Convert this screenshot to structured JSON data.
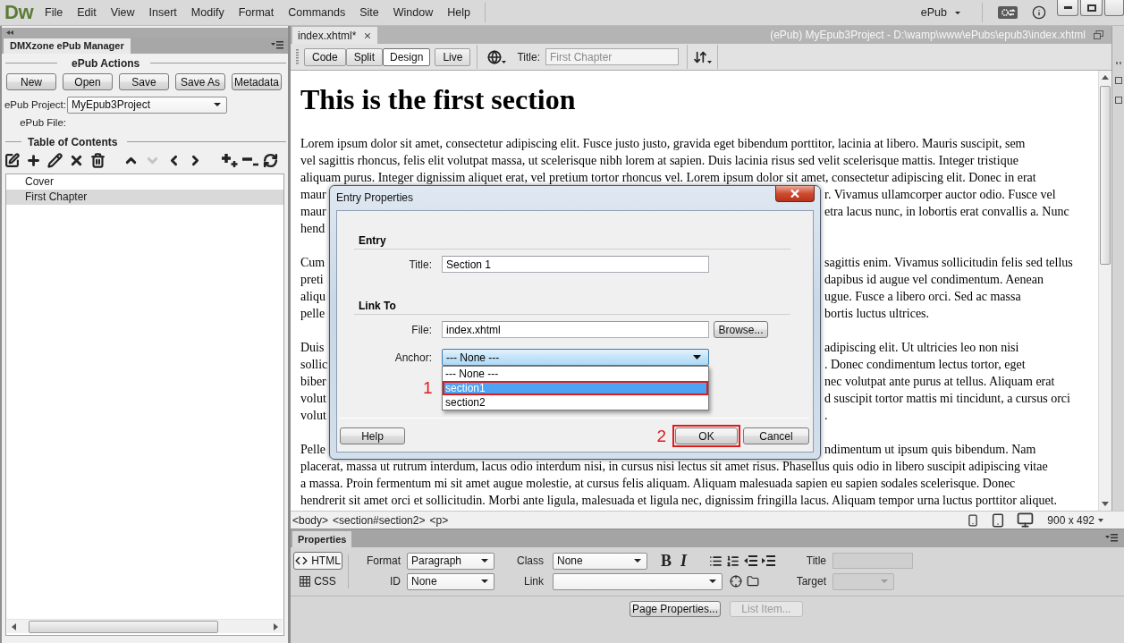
{
  "menu_bar": {
    "logo": "Dw",
    "items": [
      "File",
      "Edit",
      "View",
      "Insert",
      "Modify",
      "Format",
      "Commands",
      "Site",
      "Window",
      "Help"
    ],
    "workspace": "ePub"
  },
  "epub_manager": {
    "tab": "DMXzone ePub Manager",
    "actions_title": "ePub Actions",
    "buttons": [
      "New",
      "Open",
      "Save",
      "Save As",
      "Metadata"
    ],
    "project_label": "ePub Project:",
    "project_value": "MyEpub3Project",
    "file_label": "ePub File:",
    "toc_title": "Table of Contents",
    "move_down_disabled": true,
    "toc_items": [
      {
        "label": "Cover",
        "selected": false
      },
      {
        "label": "First Chapter",
        "selected": true
      }
    ]
  },
  "document": {
    "tab": "index.xhtml*",
    "path": "(ePub) MyEpub3Project - D:\\wamp\\www\\ePubs\\epub3\\index.xhtml",
    "views": [
      {
        "label": "Code",
        "selected": false
      },
      {
        "label": "Split",
        "selected": false
      },
      {
        "label": "Design",
        "selected": true
      },
      {
        "label": "Live",
        "selected": false
      }
    ],
    "title_label": "Title:",
    "title_value": "First Chapter",
    "heading": "This is the first section",
    "paragraphs": [
      {
        "lines": [
          {
            "text": "Lorem ipsum dolor sit amet, consectetur adipiscing elit. Fusce justo justo, gravida eget bibendum porttitor, lacinia at libero. Mauris suscipit, sem"
          },
          {
            "text": "vel sagittis rhoncus, felis elit volutpat massa, ut scelerisque nibh lorem at sapien. Duis lacinia risus sed velit scelerisque mattis. Integer tristique"
          },
          {
            "text": "aliquam purus. Integer dignissim aliquet erat, vel pretium tortor rhoncus vel. Lorem ipsum dolor sit amet, consectetur adipiscing elit. Donec in erat"
          },
          {
            "start": "maur",
            "end": "r. Vivamus ullamcorper auctor odio. Fusce vel"
          },
          {
            "start": "maur",
            "end": "etra lacus nunc, in lobortis erat convallis a. Nunc"
          },
          {
            "start": "hend"
          }
        ]
      },
      {
        "lines": [
          {
            "start": "Cum",
            "end": "sagittis enim. Vivamus sollicitudin felis sed tellus"
          },
          {
            "start": "preti",
            "end": "dapibus id augue vel condimentum. Aenean"
          },
          {
            "start": "aliqu",
            "end": "ugue. Fusce a libero orci. Sed ac massa"
          },
          {
            "start": "pelle",
            "end": "bortis luctus ultrices."
          }
        ]
      },
      {
        "lines": [
          {
            "start": "Duis",
            "end": "adipiscing elit. Ut ultricies leo non nisi"
          },
          {
            "start": "sollic",
            "end": ". Donec condimentum lectus tortor, eget"
          },
          {
            "start": "biber",
            "end": "nec volutpat ante purus at tellus. Aliquam erat"
          },
          {
            "start": "volut",
            "end": "d suscipit tortor mattis mi tincidunt, a cursus orci"
          },
          {
            "start": "volut",
            "end": "."
          }
        ]
      },
      {
        "lines": [
          {
            "start": "Pelle",
            "end": "ndimentum ut ipsum quis bibendum. Nam"
          },
          {
            "text": "placerat, massa ut rutrum interdum, lacus odio interdum nisi, in cursus nisi lectus sit amet risus. Phasellus quis odio in libero suscipit adipiscing vitae"
          },
          {
            "text": "a massa. Proin fermentum mi sit amet augue molestie, at cursus felis aliquam. Aliquam malesuada sapien eu sapien sodales scelerisque. Donec"
          },
          {
            "text": "hendrerit sit amet orci et sollicitudin. Morbi ante ligula, malesuada et ligula nec, dignissim fringilla lacus. Aliquam tempor urna luctus porttitor aliquet."
          }
        ]
      }
    ]
  },
  "dialog": {
    "title": "Entry Properties",
    "entry_heading": "Entry",
    "title_label": "Title:",
    "title_value": "Section 1",
    "link_heading": "Link To",
    "file_label": "File:",
    "file_value": "index.xhtml",
    "browse": "Browse...",
    "anchor_label": "Anchor:",
    "anchor_value": "--- None ---",
    "anchor_open": true,
    "anchor_options": [
      {
        "label": "--- None ---",
        "selected": false
      },
      {
        "label": "section1",
        "selected": true,
        "annotation": "1"
      },
      {
        "label": "section2",
        "selected": false
      }
    ],
    "buttons": [
      {
        "label": "Help"
      },
      {
        "label": "OK",
        "annotation": "2"
      },
      {
        "label": "Cancel"
      }
    ]
  },
  "status_bar": {
    "tags": [
      "<body>",
      "<section#section2>",
      "<p>"
    ],
    "size": "900 x 492"
  },
  "properties": {
    "tab": "Properties",
    "modes": [
      {
        "label": "HTML",
        "selected": true
      },
      {
        "label": "CSS",
        "selected": false
      }
    ],
    "format_label": "Format",
    "format_value": "Paragraph",
    "id_label": "ID",
    "id_value": "None",
    "class_label": "Class",
    "class_value": "None",
    "bold_label": "B",
    "italic_label": "I",
    "link_label": "Link",
    "title_label": "Title",
    "title_disabled": true,
    "target_label": "Target",
    "target_disabled": true,
    "buttons": [
      {
        "label": "Page Properties...",
        "disabled": false
      },
      {
        "label": "List Item...",
        "disabled": true
      }
    ]
  }
}
